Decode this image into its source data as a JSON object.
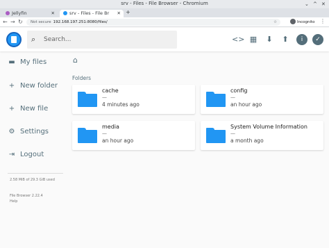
{
  "browser": {
    "window_title": "srv - Files - File Browser - Chromium",
    "controls": {
      "minimize": "⌄",
      "maximize": "^",
      "close": "✕"
    },
    "tabs": [
      {
        "label": "Jellyfin",
        "favicon_color": "#aa5cc3",
        "close": "✕"
      },
      {
        "label": "srv - Files - File Br",
        "favicon_color": "#2196f3",
        "close": "✕"
      }
    ],
    "new_tab": "+",
    "nav": {
      "back": "←",
      "forward": "→",
      "reload": "↻"
    },
    "address": {
      "security": "Not secure",
      "url": "192.168.197.251:8080/files/",
      "star": "☆"
    },
    "profile": "Incognito",
    "menu": "⋮"
  },
  "header": {
    "search_placeholder": "Search...",
    "search_icon": "⌕",
    "icons": {
      "code": "<>",
      "grid": "▦",
      "download": "⬇",
      "upload": "⬆",
      "info": "i",
      "select": "✓"
    }
  },
  "sidebar": {
    "items": [
      {
        "label": "My files",
        "icon": "▬"
      },
      {
        "label": "New folder",
        "icon": "+"
      },
      {
        "label": "New file",
        "icon": "+"
      },
      {
        "label": "Settings",
        "icon": "⚙"
      },
      {
        "label": "Logout",
        "icon": "⇥"
      }
    ],
    "usage": "2.58 MiB of 29.3 GiB used",
    "version": "File Browser 2.22.4",
    "help": "Help"
  },
  "main": {
    "home_icon": "⌂",
    "folders_heading": "Folders",
    "folders": [
      {
        "name": "cache",
        "size": "—",
        "modified": "4 minutes ago"
      },
      {
        "name": "config",
        "size": "—",
        "modified": "an hour ago"
      },
      {
        "name": "media",
        "size": "—",
        "modified": "an hour ago"
      },
      {
        "name": "System Volume Information",
        "size": "—",
        "modified": "a month ago"
      }
    ]
  },
  "colors": {
    "accent": "#2196f3",
    "icon": "#546e7a"
  }
}
